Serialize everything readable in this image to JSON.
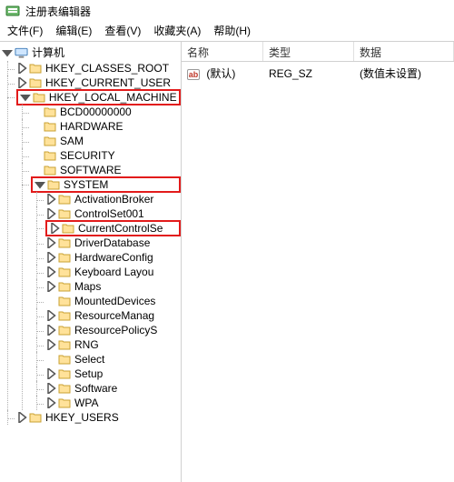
{
  "title": "注册表编辑器",
  "menu": {
    "file": "文件(F)",
    "edit": "编辑(E)",
    "view": "查看(V)",
    "fav": "收藏夹(A)",
    "help": "帮助(H)"
  },
  "columns": {
    "name": "名称",
    "type": "类型",
    "data": "数据"
  },
  "list": {
    "default_name": "(默认)",
    "default_type": "REG_SZ",
    "default_data": "(数值未设置)"
  },
  "tree": {
    "root": "计算机",
    "hives": {
      "hkcr": "HKEY_CLASSES_ROOT",
      "hkcu": "HKEY_CURRENT_USER",
      "hklm": "HKEY_LOCAL_MACHINE",
      "hku": "HKEY_USERS"
    },
    "hklm": {
      "bcd": "BCD00000000",
      "hw": "HARDWARE",
      "sam": "SAM",
      "security": "SECURITY",
      "software": "SOFTWARE",
      "system": "SYSTEM"
    },
    "system": {
      "activation": "ActivationBroker",
      "ccs1": "ControlSet001",
      "ccs": "CurrentControlSe",
      "driverdb": "DriverDatabase",
      "hwconfig": "HardwareConfig",
      "kbd": "Keyboard Layou",
      "maps": "Maps",
      "mounted": "MountedDevices",
      "resman": "ResourceManag",
      "respol": "ResourcePolicyS",
      "rng": "RNG",
      "select": "Select",
      "setup": "Setup",
      "sw": "Software",
      "wpa": "WPA"
    }
  }
}
